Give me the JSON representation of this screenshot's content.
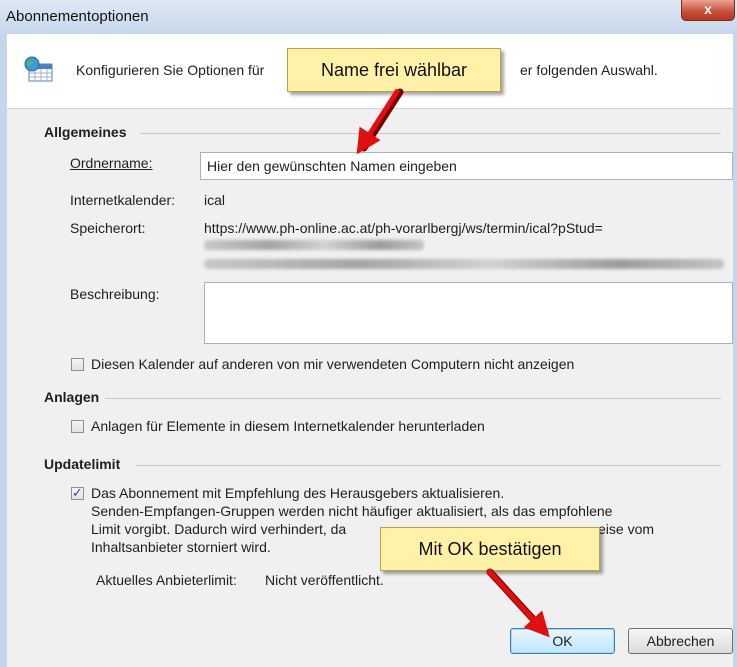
{
  "window": {
    "title": "Abonnementoptionen",
    "close_label": "x"
  },
  "header": {
    "text_left": "Konfigurieren Sie Optionen für",
    "text_right": "er folgenden Auswahl."
  },
  "general": {
    "group_title": "Allgemeines",
    "folder_label": "Ordnername:",
    "folder_value": "Hier den gewünschten Namen eingeben",
    "calendar_label": "Internetkalender:",
    "calendar_value": "ical",
    "location_label": "Speicherort:",
    "location_value": "https://www.ph-online.ac.at/ph-vorarlbergj/ws/termin/ical?pStud=",
    "description_label": "Beschreibung:",
    "hide_label": "Diesen Kalender auf anderen von mir verwendeten Computern nicht anzeigen"
  },
  "attachments": {
    "group_title": "Anlagen",
    "download_label": "Anlagen für Elemente in diesem Internetkalender herunterladen"
  },
  "update": {
    "group_title": "Updatelimit",
    "line1": "Das Abonnement mit Empfehlung des Herausgebers aktualisieren.",
    "line2": "Senden-Empfangen-Gruppen werden nicht häufiger aktualisiert, als das empfohlene",
    "line3a": "Limit vorgibt. Dadurch wird verhindert, da",
    "line3b": "eise vom",
    "line4": "Inhaltsanbieter storniert wird.",
    "limit_label": "Aktuelles Anbieterlimit:",
    "limit_value": "Nicht veröffentlicht."
  },
  "buttons": {
    "ok": "OK",
    "cancel": "Abbrechen"
  },
  "callouts": {
    "name": "Name frei wählbar",
    "ok": "Mit OK bestätigen"
  },
  "colors": {
    "callout_bg": "#fff2a8",
    "arrow": "#e01010"
  }
}
